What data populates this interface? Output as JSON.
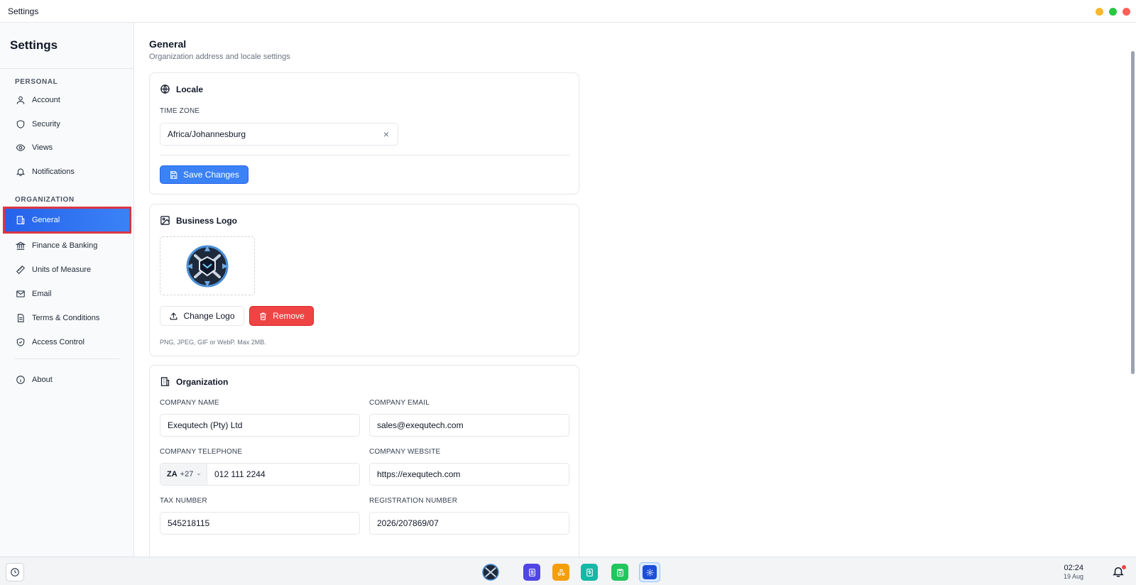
{
  "window": {
    "title": "Settings"
  },
  "sidebar": {
    "title": "Settings",
    "sections": {
      "personal": "PERSONAL",
      "organization": "ORGANIZATION"
    },
    "items": {
      "account": "Account",
      "security": "Security",
      "views": "Views",
      "notifications": "Notifications",
      "general": "General",
      "finance": "Finance & Banking",
      "units": "Units of Measure",
      "email": "Email",
      "terms": "Terms & Conditions",
      "access": "Access Control",
      "about": "About"
    }
  },
  "page": {
    "title": "General",
    "subtitle": "Organization address and locale settings"
  },
  "locale": {
    "heading": "Locale",
    "timezone_label": "TIME ZONE",
    "timezone_value": "Africa/Johannesburg",
    "clear_glyph": "×",
    "save_label": "Save Changes"
  },
  "logo": {
    "heading": "Business Logo",
    "change_label": "Change Logo",
    "remove_label": "Remove",
    "hint": "PNG, JPEG, GIF or WebP. Max 2MB."
  },
  "organization": {
    "heading": "Organization",
    "company_name_label": "COMPANY NAME",
    "company_name_value": "Exequtech (Pty) Ltd",
    "company_email_label": "COMPANY EMAIL",
    "company_email_value": "sales@exequtech.com",
    "company_telephone_label": "COMPANY TELEPHONE",
    "phone_country": "ZA",
    "phone_code": "+27",
    "phone_number": "012 111 2244",
    "company_website_label": "COMPANY WEBSITE",
    "company_website_value": "https://exequtech.com",
    "tax_number_label": "TAX NUMBER",
    "tax_number_value": "545218115",
    "registration_number_label": "REGISTRATION NUMBER",
    "registration_number_value": "2026/207869/07"
  },
  "taskbar": {
    "time": "02:24",
    "date": "19 Aug"
  },
  "colors": {
    "accent": "#3b82f6",
    "danger": "#ef4444",
    "highlight_outline": "#dc3545",
    "traffic_yellow": "#f5b82e",
    "traffic_green": "#28c840",
    "traffic_red": "#ff5f57"
  }
}
